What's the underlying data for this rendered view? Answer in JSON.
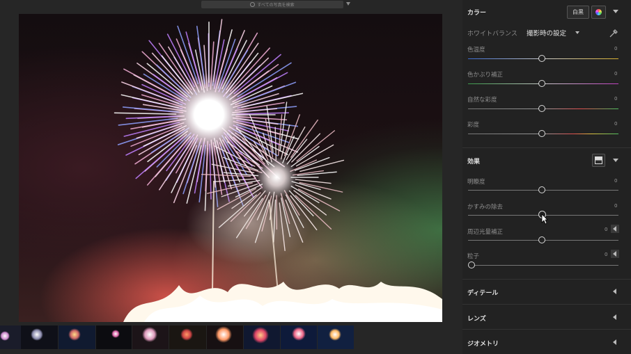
{
  "search": {
    "placeholder": "すべての写真を検索"
  },
  "filmstrip": {
    "thumbnails": [
      "fireworks-1",
      "fireworks-2",
      "fireworks-3",
      "fireworks-4",
      "fireworks-5",
      "fireworks-6",
      "fireworks-7",
      "fireworks-8",
      "fireworks-9",
      "fireworks-10"
    ]
  },
  "color_panel": {
    "title": "カラー",
    "bw_button": "白黒",
    "white_balance_label": "ホワイトバランス",
    "white_balance_value": "撮影時の設定",
    "sliders": [
      {
        "label": "色温度",
        "value": "0"
      },
      {
        "label": "色かぶり補正",
        "value": "0"
      },
      {
        "label": "自然な彩度",
        "value": "0"
      },
      {
        "label": "彩度",
        "value": "0"
      }
    ]
  },
  "effects_panel": {
    "title": "効果",
    "sliders": [
      {
        "label": "明瞭度",
        "value": "0"
      },
      {
        "label": "かすみの除去",
        "value": "0"
      },
      {
        "label": "周辺光量補正",
        "value": "0"
      },
      {
        "label": "粒子",
        "value": "0"
      }
    ]
  },
  "detail_panel": {
    "title": "ディテール"
  },
  "lens_panel": {
    "title": "レンズ"
  },
  "geometry_panel": {
    "title": "ジオメトリ"
  }
}
